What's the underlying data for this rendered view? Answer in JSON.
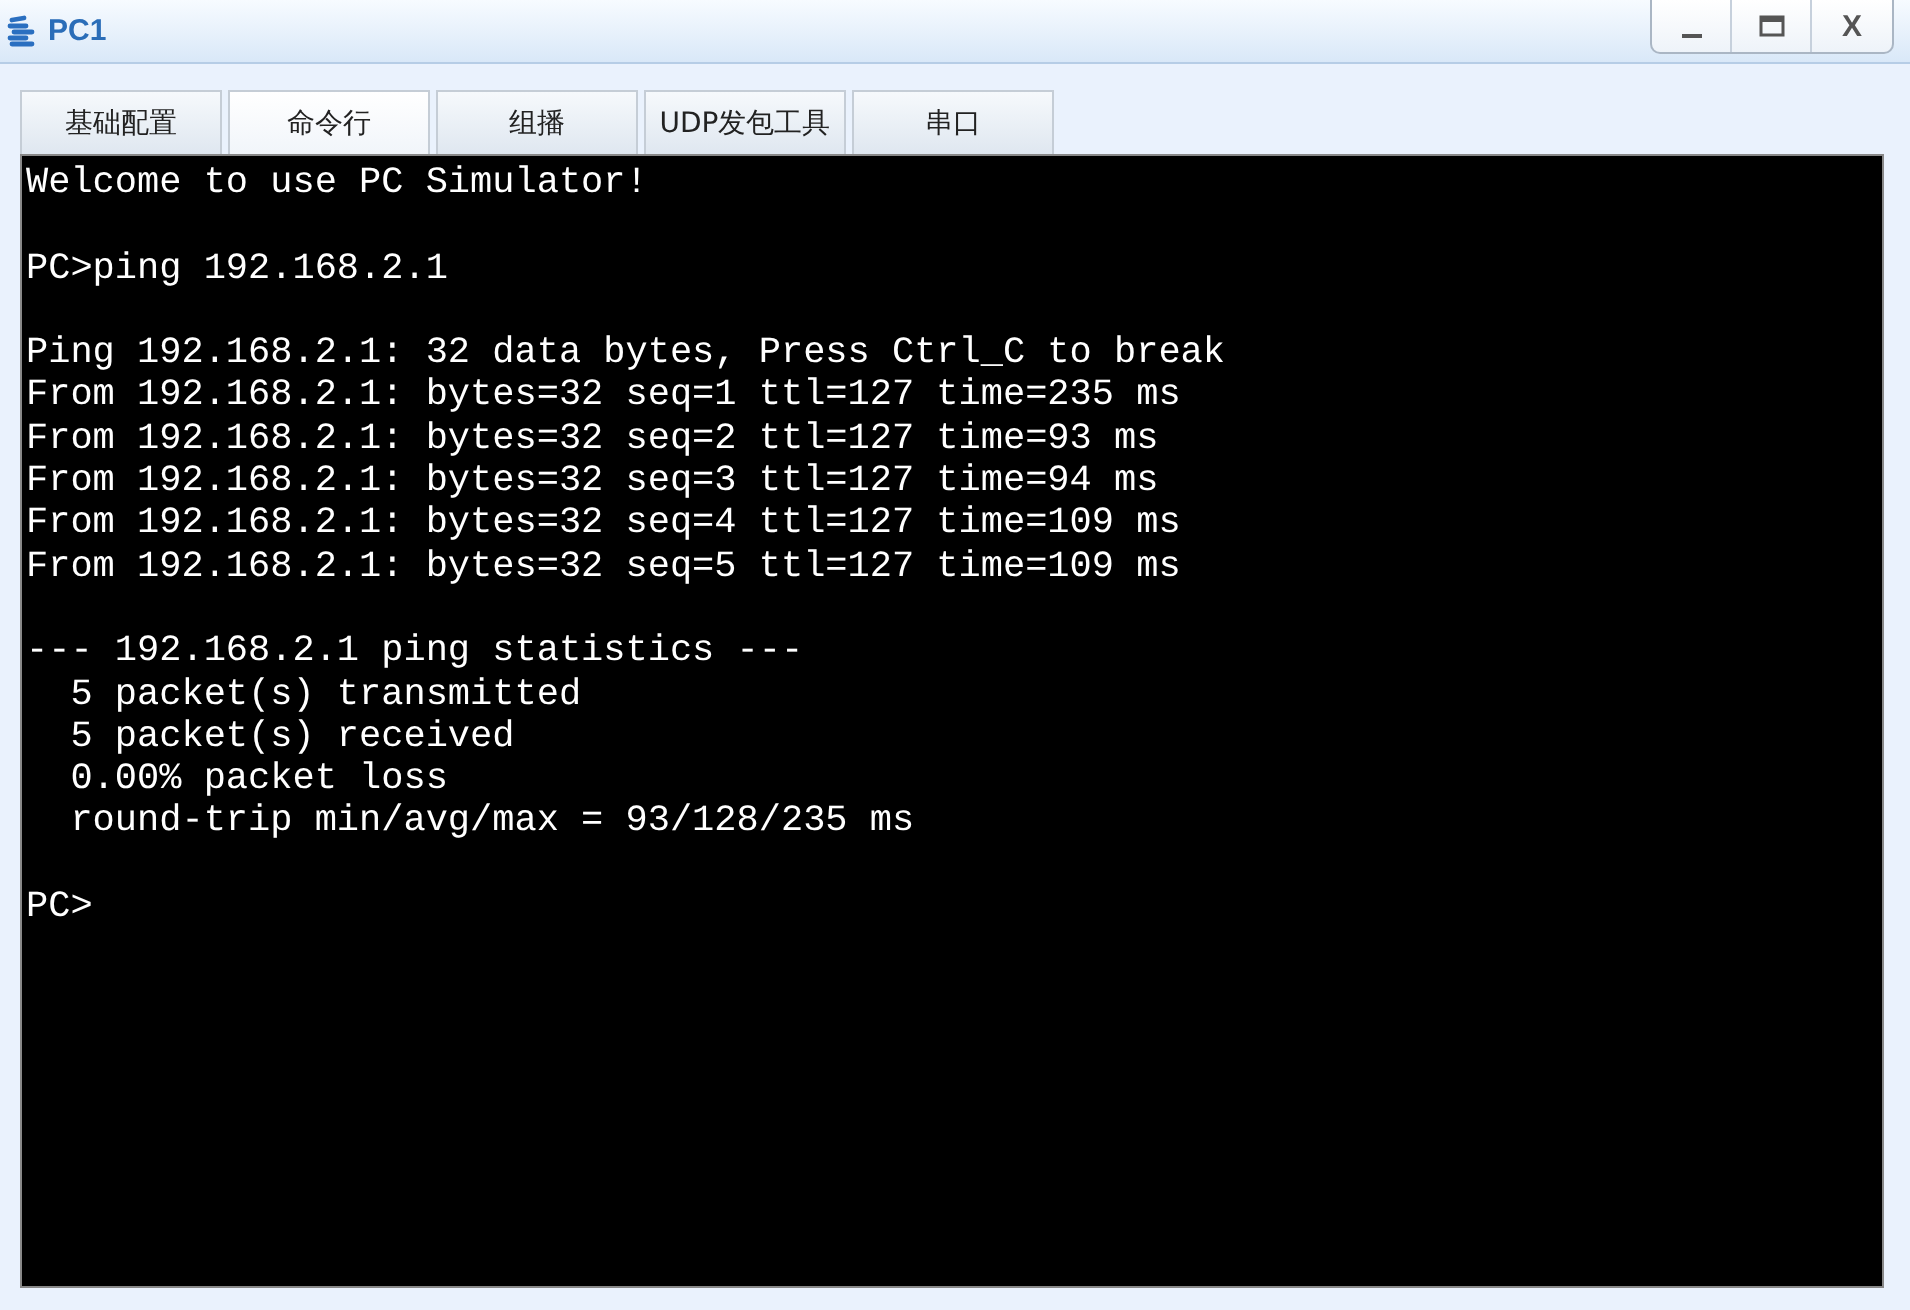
{
  "window": {
    "title": "PC1",
    "controls": [
      {
        "kind": "minimize"
      },
      {
        "kind": "maximize"
      },
      {
        "kind": "close",
        "label": "X"
      }
    ]
  },
  "tabs": [
    {
      "label": "基础配置",
      "selected": false
    },
    {
      "label": "命令行",
      "selected": true
    },
    {
      "label": "组播",
      "selected": false
    },
    {
      "label": "UDP发包工具",
      "selected": false
    },
    {
      "label": "串口",
      "selected": false
    }
  ],
  "terminal": {
    "blocks": [
      [
        "Welcome to use PC Simulator!"
      ],
      [
        "PC>ping 192.168.2.1"
      ],
      [
        "Ping 192.168.2.1: 32 data bytes, Press Ctrl_C to break",
        "From 192.168.2.1: bytes=32 seq=1 ttl=127 time=235 ms",
        "From 192.168.2.1: bytes=32 seq=2 ttl=127 time=93 ms",
        "From 192.168.2.1: bytes=32 seq=3 ttl=127 time=94 ms",
        "From 192.168.2.1: bytes=32 seq=4 ttl=127 time=109 ms",
        "From 192.168.2.1: bytes=32 seq=5 ttl=127 time=109 ms"
      ],
      [
        "--- 192.168.2.1 ping statistics ---",
        "  5 packet(s) transmitted",
        "  5 packet(s) received",
        "  0.00% packet loss",
        "  round-trip min/avg/max = 93/128/235 ms"
      ],
      [
        "PC>"
      ]
    ]
  }
}
